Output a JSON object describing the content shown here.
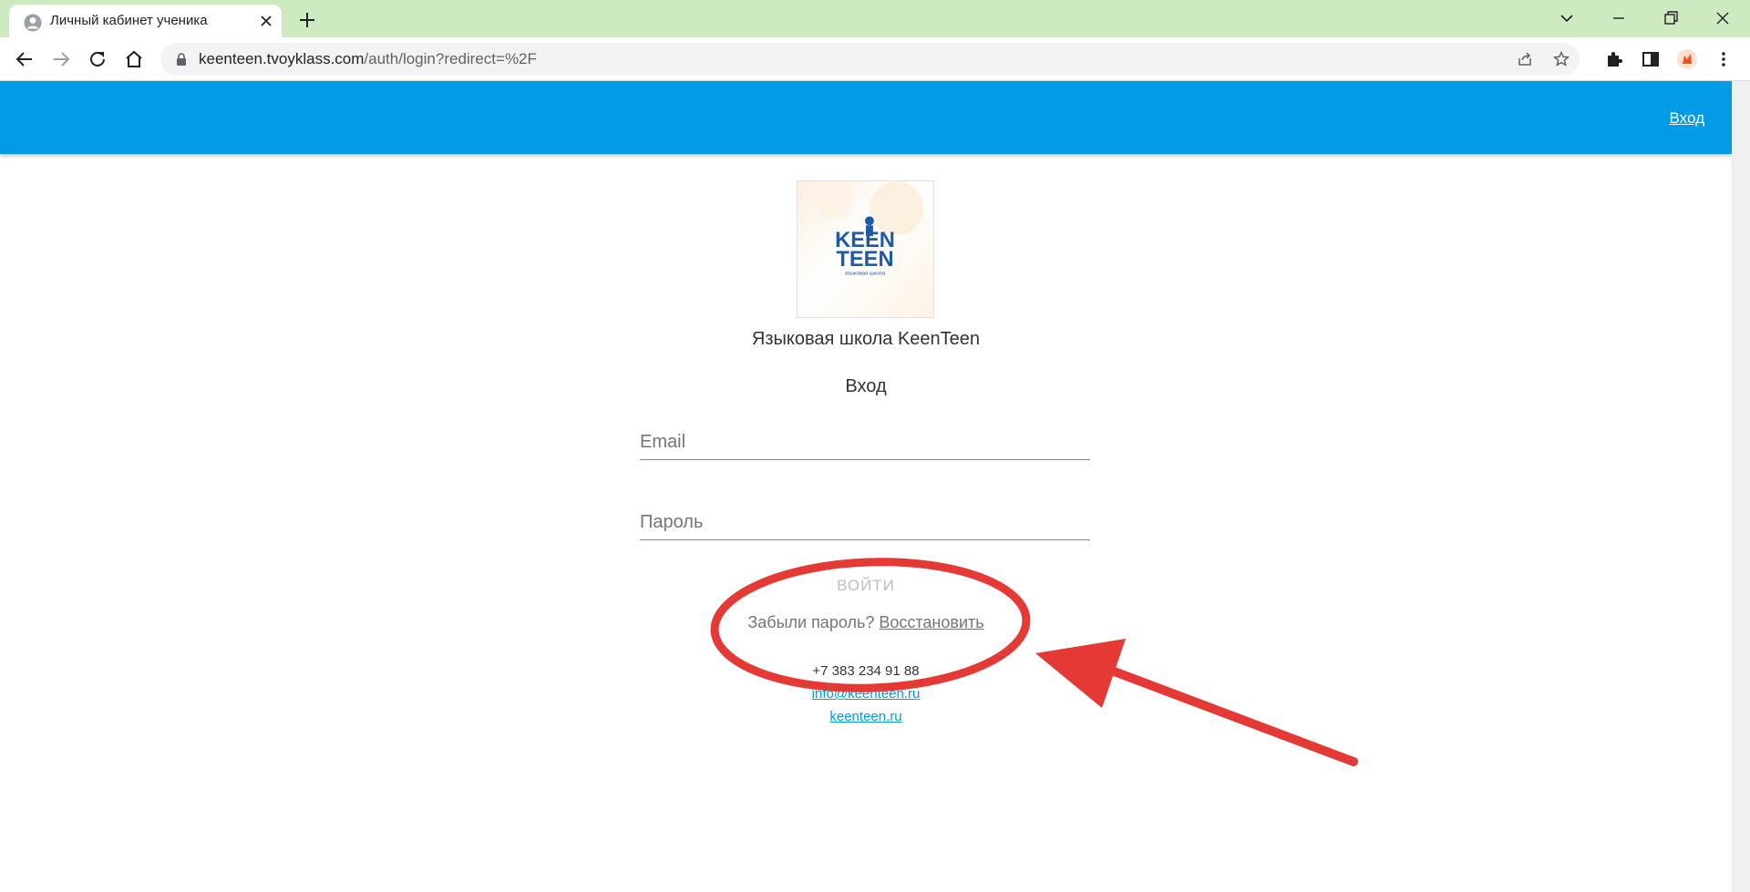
{
  "browser": {
    "tab_title": "Личный кабинет ученика",
    "url_host": "keenteen.tvoyklass.com",
    "url_path": "/auth/login?redirect=%2F"
  },
  "appbar": {
    "login_link": "Вход"
  },
  "logo": {
    "text_line1": "KEEN",
    "text_line2": "TEEN",
    "caption": "языковая школа",
    "accent_color": "#1f5aa6"
  },
  "page": {
    "school_name": "Языковая школа KeenTeen",
    "form_title": "Вход",
    "email_placeholder": "Email",
    "password_placeholder": "Пароль",
    "submit_label": "ВОЙТИ",
    "forgot_question": "Забыли пароль?",
    "restore_link": "Восстановить"
  },
  "contacts": {
    "phone": "+7 383 234 91 88",
    "email": "info@keenteen.ru",
    "site": "keenteen.ru"
  },
  "colors": {
    "appbar": "#039be5",
    "annotation": "#e53935",
    "tabstrip": "#cdeac0"
  }
}
